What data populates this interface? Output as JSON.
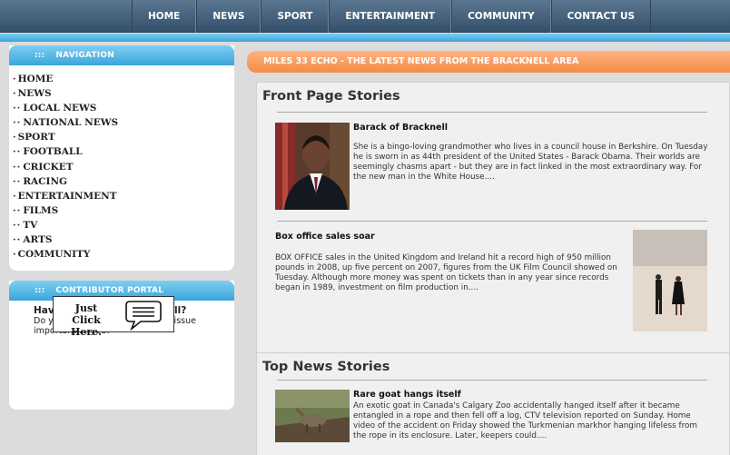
{
  "topnav": [
    "HOME",
    "NEWS",
    "SPORT",
    "ENTERTAINMENT",
    "COMMUNITY",
    "CONTACT US"
  ],
  "sidebar": {
    "nav_title": "NAVIGATION",
    "dots": ":::",
    "items": [
      {
        "label": "HOME",
        "bullet": "·"
      },
      {
        "label": "NEWS",
        "bullet": "·"
      },
      {
        "label": "LOCAL NEWS",
        "bullet": "··"
      },
      {
        "label": "NATIONAL NEWS",
        "bullet": "··"
      },
      {
        "label": "SPORT",
        "bullet": "·"
      },
      {
        "label": "FOOTBALL",
        "bullet": "··"
      },
      {
        "label": "CRICKET",
        "bullet": "··"
      },
      {
        "label": "RACING",
        "bullet": "··"
      },
      {
        "label": "ENTERTAINMENT",
        "bullet": "·"
      },
      {
        "label": "FILMS",
        "bullet": "··"
      },
      {
        "label": "TV",
        "bullet": "··"
      },
      {
        "label": "ARTS",
        "bullet": "··"
      },
      {
        "label": "COMMUNITY",
        "bullet": "·"
      }
    ],
    "portal_title": "CONTRIBUTOR PORTAL",
    "portal_question": "Have you got a story to tell?",
    "portal_text": "Do you want us to follow a local issue important to you?",
    "click_label_line1": "Just Click",
    "click_label_line2": "Here."
  },
  "main": {
    "banner": "MILES 33 ECHO - THE LATEST NEWS FROM THE BRACKNELL AREA",
    "front_heading": "Front Page Stories",
    "story1_title": "Barack of Bracknell",
    "story1_text": "She is a bingo-loving grandmother who lives in a council house in Berkshire. On Tuesday he is sworn in as 44th president of the United States - Barack Obama. Their worlds are seemingly chasms apart - but they are in fact linked in the most extraordinary way. For the new man in the White House....",
    "story2_title": "Box office sales soar",
    "story2_text": "BOX OFFICE sales in the United Kingdom and Ireland hit a record high of 950 million pounds in 2008, up five percent on 2007, figures from the UK Film Council showed on Tuesday. Although more money was spent on tickets than in any year since records began in 1989, investment on film production in....",
    "top_heading": "Top News Stories",
    "story3_title": "Rare goat hangs itself",
    "story3_text": "An exotic goat in Canada's Calgary Zoo accidentally hanged itself after it became entangled in a rope and then fell off a log, CTV television reported on Sunday. Home video of the accident on Friday showed the Turkmenian markhor hanging lifeless from the rope in its enclosure. Later, keepers could...."
  }
}
